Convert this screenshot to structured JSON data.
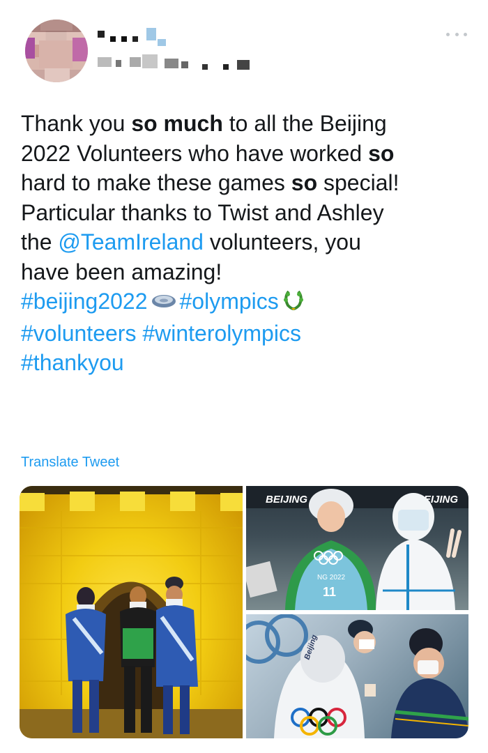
{
  "header": {
    "avatar": "blurred profile avatar",
    "display_name": "",
    "handle": "",
    "more_icon": "more-horizontal-icon"
  },
  "tweet": {
    "lines": [
      [
        {
          "t": "Thank you "
        },
        {
          "t": "so much",
          "b": true
        },
        {
          "t": " to all the Beijing"
        }
      ],
      [
        {
          "t": "2022 Volunteers who have worked "
        },
        {
          "t": "so",
          "b": true
        }
      ],
      [
        {
          "t": "hard to make these games "
        },
        {
          "t": "so",
          "b": true
        },
        {
          "t": " special!"
        }
      ],
      [
        {
          "t": "Particular thanks to Twist and Ashley"
        }
      ],
      [
        {
          "t": "the "
        },
        {
          "t": "@TeamIreland",
          "link": true
        },
        {
          "t": " volunteers, you"
        }
      ],
      [
        {
          "t": "have been amazing!"
        }
      ],
      [
        {
          "t": "#beijing2022",
          "link": true
        },
        {
          "emoji": "disc"
        },
        {
          "t": "#olympics",
          "link": true
        },
        {
          "emoji": "wreath"
        }
      ],
      [
        {
          "t": "#volunteers #winterolympics",
          "link": true
        }
      ],
      [
        {
          "t": "#thankyou",
          "link": true
        }
      ]
    ],
    "translate_label": "Translate Tweet"
  },
  "media": {
    "photo_1": {
      "signs": []
    },
    "photo_2": {
      "signs": [
        "BEIJING",
        "BEIJING"
      ],
      "bib": "11",
      "bib_text": "NG 2022"
    },
    "photo_3": {
      "signs": [
        "Beijing"
      ]
    }
  },
  "colors": {
    "link": "#1d9bf0",
    "text": "#14171a",
    "muted": "#c4c8cc"
  }
}
